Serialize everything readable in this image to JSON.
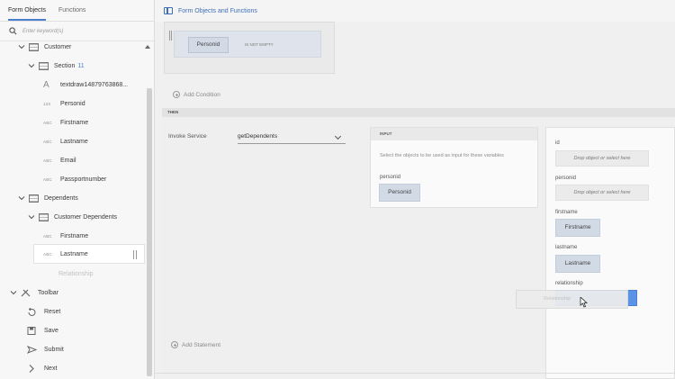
{
  "sidebar": {
    "tabs": [
      {
        "label": "Form Objects"
      },
      {
        "label": "Functions"
      }
    ],
    "search_placeholder": "Enter keyword(s)",
    "tree": {
      "customer": "Customer",
      "section": "Section",
      "section_count": "11",
      "textdraw": "textdraw14879763868...",
      "personid": "Personid",
      "firstname": "Firstname",
      "lastname": "Lastname",
      "email": "Email",
      "passport": "Passportnumber",
      "dependents": "Dependents",
      "customer_dependents": "Customer Dependents",
      "dep_firstname": "Firstname",
      "dep_lastname": "Lastname",
      "dep_relationship": "Relationship",
      "toolbar": "Toolbar",
      "reset": "Reset",
      "save": "Save",
      "submit": "Submit",
      "next": "Next"
    },
    "type_labels": {
      "number": "123",
      "text": "ABC",
      "draw": "A"
    }
  },
  "main": {
    "breadcrumb": "Form Objects and Functions",
    "condition": {
      "field": "Personid",
      "operator": "IS NOT EMPTY"
    },
    "add_condition": "Add Condition",
    "then_label": "THEN",
    "invoke_label": "Invoke Service",
    "service_value": "getDependents",
    "input": {
      "header": "INPUT",
      "hint": "Select the objects to be used as input for these variables",
      "param_label": "personid",
      "param_value": "Personid"
    },
    "output": {
      "id_label": "id",
      "id_drop": "Drop object or select here",
      "personid_label": "personid",
      "personid_drop": "Drop object or select here",
      "firstname_label": "firstname",
      "firstname_value": "Firstname",
      "lastname_label": "lastname",
      "lastname_value": "Lastname",
      "relationship_label": "relationship"
    },
    "drag_ghost": "Relationship",
    "add_statement": "Add Statement"
  },
  "colors": {
    "accent": "#4a7fd1",
    "chip": "#d2dae6",
    "drop_highlight": "#5b93e6"
  }
}
